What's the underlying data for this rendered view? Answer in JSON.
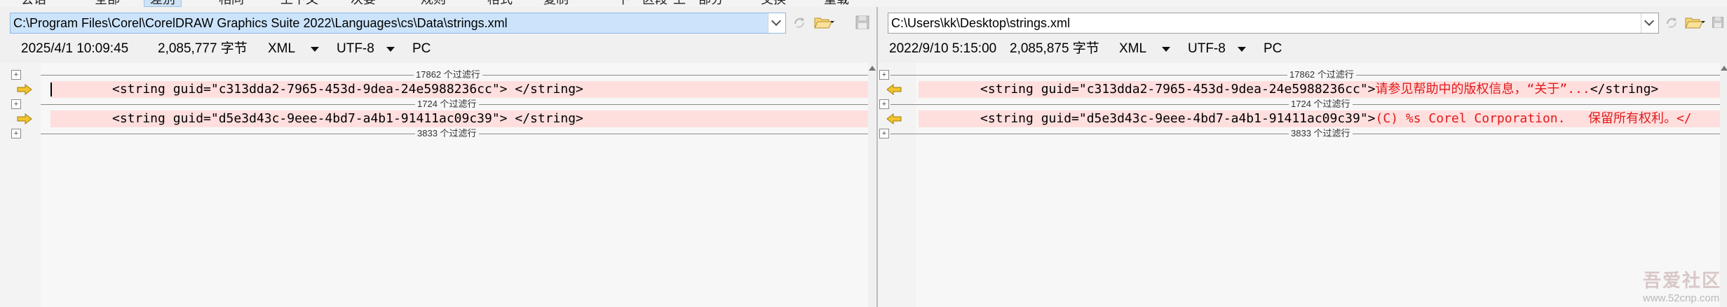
{
  "toolbar": {
    "items": [
      {
        "label": "全部"
      },
      {
        "label": "差别"
      },
      {
        "label": "相同"
      },
      {
        "label": "上下文"
      },
      {
        "label": "次要"
      },
      {
        "label": "规则"
      },
      {
        "label": "格式"
      },
      {
        "label": "复制"
      },
      {
        "label": "下一区段"
      },
      {
        "label": "上一部分"
      },
      {
        "label": "交换"
      },
      {
        "label": "重载"
      }
    ],
    "first_partial": "会话",
    "active_index": 1
  },
  "left": {
    "path": "C:\\Program Files\\Corel\\CorelDRAW Graphics Suite 2022\\Languages\\cs\\Data\\strings.xml",
    "info": {
      "datetime": "2025/4/1 10:09:45",
      "size": "2,085,777 字节",
      "format": "XML",
      "encoding": "UTF-8",
      "line_endings": "PC"
    },
    "filters": [
      "17862 个过滤行",
      "1724 个过滤行",
      "3833 个过滤行"
    ],
    "rows": [
      {
        "code": "<string guid=\"c313dda2-7965-453d-9dea-24e5988236cc\"> </string>",
        "red": ""
      },
      {
        "code": "<string guid=\"d5e3d43c-9eee-4bd7-a4b1-91411ac09c39\"> </string>",
        "red": ""
      }
    ]
  },
  "right": {
    "path": "C:\\Users\\kk\\Desktop\\strings.xml",
    "info": {
      "datetime": "2022/9/10 5:15:00",
      "size": "2,085,875 字节",
      "format": "XML",
      "encoding": "UTF-8",
      "line_endings": "PC"
    },
    "filters": [
      "17862 个过滤行",
      "1724 个过滤行",
      "3833 个过滤行"
    ],
    "rows": [
      {
        "code": "<string guid=\"c313dda2-7965-453d-9dea-24e5988236cc\">",
        "red": "请参见帮助中的版权信息，“关于”...",
        "tail": "</string>"
      },
      {
        "code": "<string guid=\"d5e3d43c-9eee-4bd7-a4b1-91411ac09c39\">",
        "red": "(C) %s Corel Corporation.   保留所有权利。</",
        "tail": ""
      }
    ]
  },
  "watermark": {
    "main": "吾爱社区",
    "sub": "www.52cnp.com"
  },
  "colors": {
    "diff_bg": "#ffdede",
    "changed_text": "#e01b1b",
    "path_selected": "#cce4fb",
    "arrow": "#f2c42e"
  }
}
